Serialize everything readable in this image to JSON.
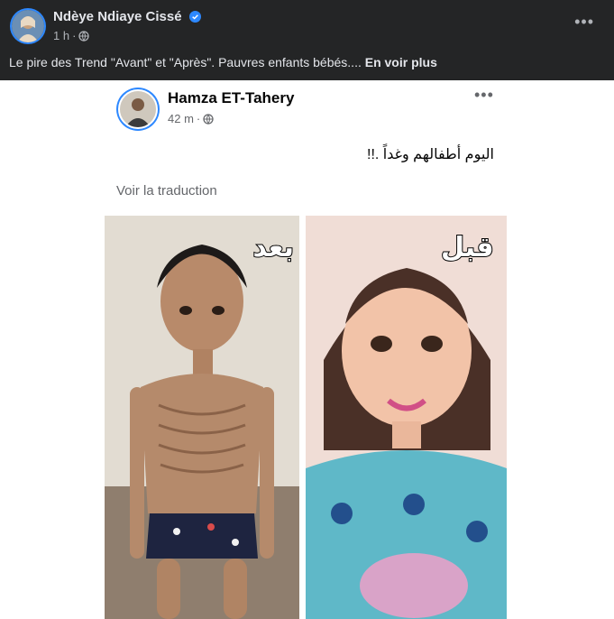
{
  "post": {
    "author": "Ndèye Ndiaye Cissé",
    "time": "1 h",
    "sep": "·",
    "more_icon": "more-horizontal-icon",
    "caption": "Le pire des Trend \"Avant\" et \"Après\". Pauvres enfants bébés.... ",
    "see_more": "En voir plus"
  },
  "shared": {
    "author": "Hamza ET-Tahery",
    "time": "42 m",
    "sep": "·",
    "text": "اليوم أطفالهم وغداً .!!",
    "translate": "Voir la traduction"
  },
  "photos": {
    "left_label": "بعد",
    "right_label": "قبل"
  },
  "colors": {
    "dark_bg": "#242526",
    "verified": "#2d88ff",
    "link": "#e4e6eb"
  }
}
